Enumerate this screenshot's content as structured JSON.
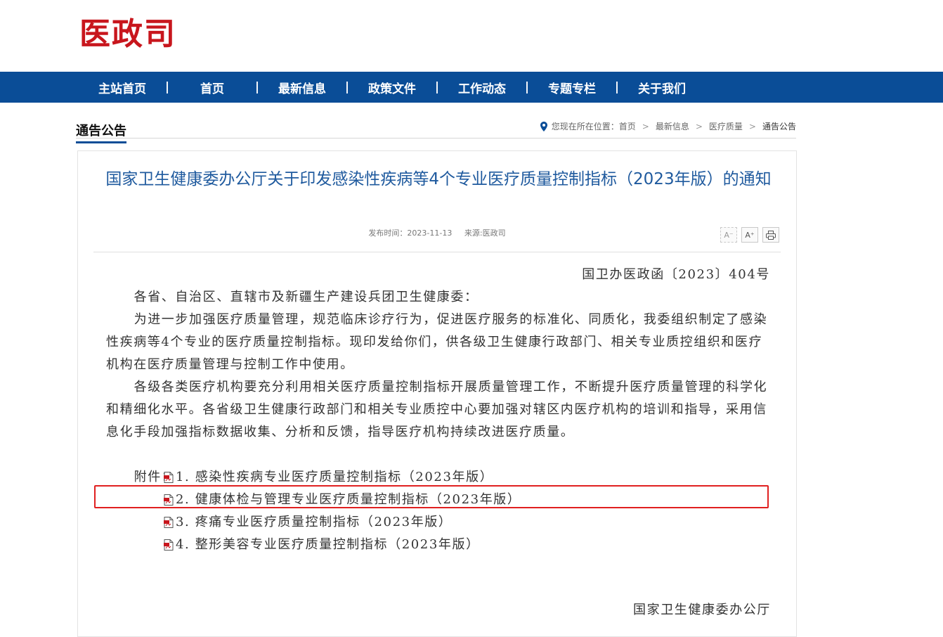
{
  "logo": {
    "text": "医政司"
  },
  "nav": {
    "items": [
      "主站首页",
      "首页",
      "最新信息",
      "政策文件",
      "工作动态",
      "专题专栏",
      "关于我们"
    ],
    "separator": "|"
  },
  "section": {
    "title": "通告公告"
  },
  "breadcrumb": {
    "prefix": "您现在所在位置：",
    "items": [
      "首页",
      "最新信息",
      "医疗质量",
      "通告公告"
    ],
    "separator": ">"
  },
  "article": {
    "title": "国家卫生健康委办公厅关于印发感染性疾病等4个专业医疗质量控制指标（2023年版）的通知",
    "meta": {
      "date_label": "发布时间：",
      "date": "2023-11-13",
      "source_label": "来源:",
      "source": "医政司"
    },
    "tools": {
      "font_smaller": "A⁻",
      "font_larger": "A⁺"
    },
    "doc_number": "国卫办医政函〔2023〕404号",
    "salutation": "各省、自治区、直辖市及新疆生产建设兵团卫生健康委：",
    "para1": "为进一步加强医疗质量管理，规范临床诊疗行为，促进医疗服务的标准化、同质化，我委组织制定了感染性疾病等4个专业的医疗质量控制指标。现印发给你们，供各级卫生健康行政部门、相关专业质控组织和医疗机构在医疗质量管理与控制工作中使用。",
    "para2": "各级各类医疗机构要充分利用相关医疗质量控制指标开展质量管理工作，不断提升医疗质量管理的科学化和精细化水平。各省级卫生健康行政部门和相关专业质控中心要加强对辖区内医疗机构的培训和指导，采用信息化手段加强指标数据收集、分析和反馈，指导医疗机构持续改进医疗质量。",
    "attachments_label": "附件：",
    "attachments": [
      "1. 感染性疾病专业医疗质量控制指标（2023年版）",
      "2. 健康体检与管理专业医疗质量控制指标（2023年版）",
      "3. 疼痛专业医疗质量控制指标（2023年版）",
      "4. 整形美容专业医疗质量控制指标（2023年版）"
    ],
    "signer": "国家卫生健康委办公厅"
  },
  "colors": {
    "nav_bg": "#0a4d97",
    "logo": "#c8161d",
    "title": "#1f5a9e",
    "highlight": "#e02020"
  }
}
